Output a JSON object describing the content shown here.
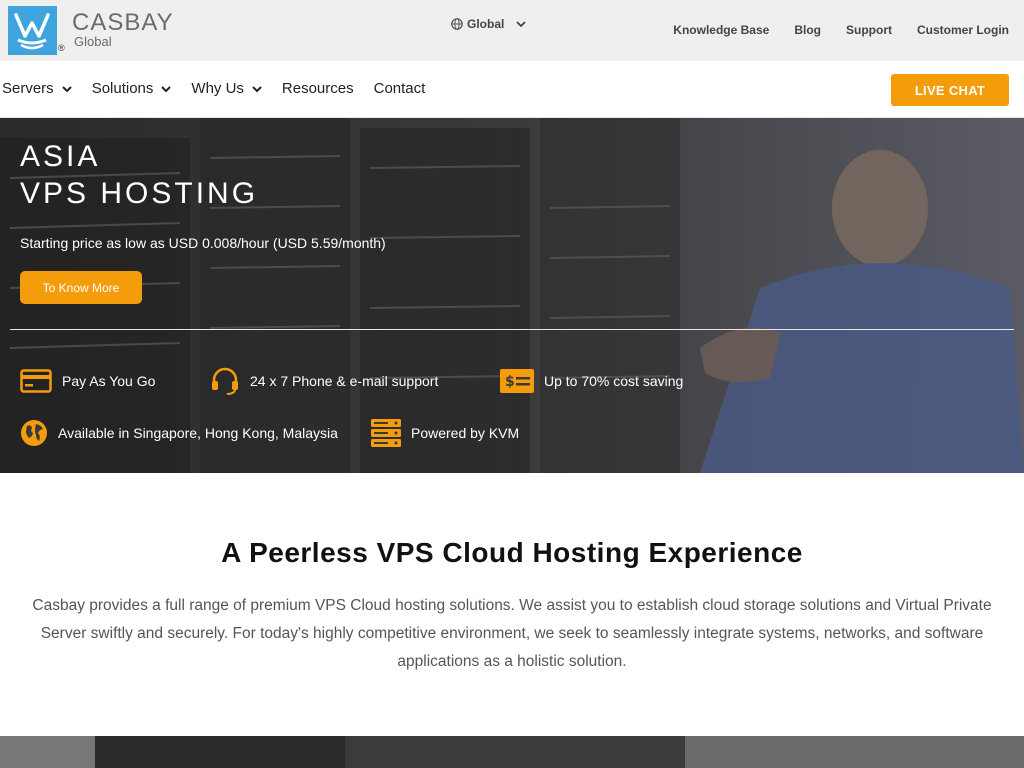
{
  "brand": {
    "name": "CASBAY",
    "sub": "Global",
    "reg": "®",
    "color": "#3fa4de"
  },
  "top": {
    "region_label": "Global",
    "links": [
      "Knowledge Base",
      "Blog",
      "Support",
      "Customer Login"
    ]
  },
  "nav": {
    "items": [
      {
        "label": "Servers",
        "has_dropdown": true
      },
      {
        "label": "Solutions",
        "has_dropdown": true
      },
      {
        "label": "Why Us",
        "has_dropdown": true
      },
      {
        "label": "Resources",
        "has_dropdown": false
      },
      {
        "label": "Contact",
        "has_dropdown": false
      }
    ],
    "live_chat": "LIVE CHAT"
  },
  "hero": {
    "title_line1": "ASIA",
    "title_line2": "VPS HOSTING",
    "subtitle": "Starting price as low as USD 0.008/hour (USD 5.59/month)",
    "cta": "To Know More",
    "features": [
      {
        "icon": "credit-card-icon",
        "label": "Pay As You Go"
      },
      {
        "icon": "headset-icon",
        "label": "24 x 7 Phone & e-mail support"
      },
      {
        "icon": "dollar-bill-icon",
        "label": "Up to 70% cost saving"
      },
      {
        "icon": "globe-icon",
        "label": "Available in Singapore, Hong Kong, Malaysia"
      },
      {
        "icon": "server-stack-icon",
        "label": "Powered by KVM"
      }
    ]
  },
  "intro": {
    "title": "A Peerless VPS Cloud Hosting Experience",
    "body": "Casbay provides a full range of premium VPS Cloud hosting solutions. We assist you to establish cloud storage solutions and Virtual Private Server swiftly and securely. For today's highly competitive environment, we seek to seamlessly integrate systems, networks, and software applications as a holistic solution."
  },
  "colors": {
    "accent": "#f59c0b",
    "topbar_bg": "#efefef"
  }
}
